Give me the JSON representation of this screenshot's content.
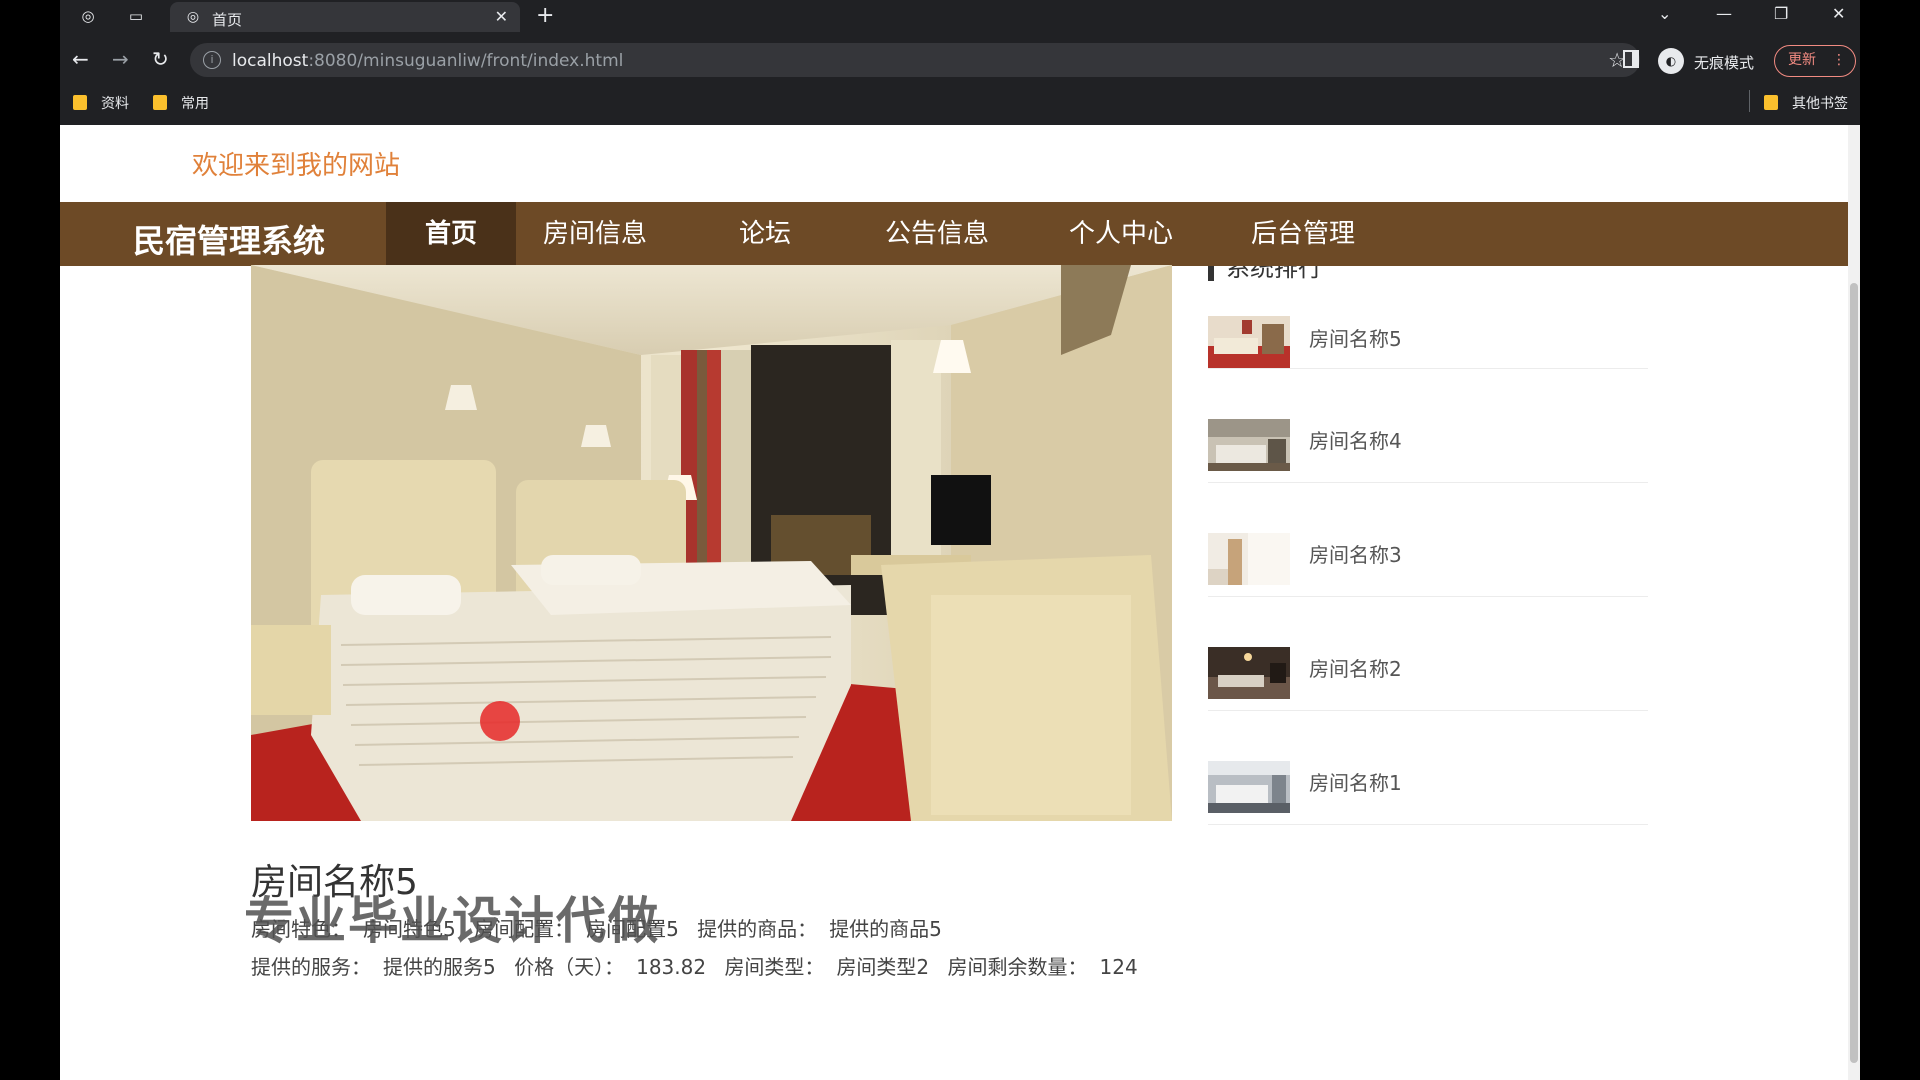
{
  "browser": {
    "tab_title": "首页",
    "url_host": "localhost",
    "url_rest": ":8080/minsuguanliw/front/index.html",
    "incognito_label": "无痕模式",
    "update_label": "更新",
    "bookmarks": [
      "资料",
      "常用"
    ],
    "other_bookmarks": "其他书签"
  },
  "site": {
    "welcome": "欢迎来到我的网站",
    "brand": "民宿管理系统",
    "nav": [
      "首页",
      "房间信息",
      "论坛",
      "公告信息",
      "个人中心",
      "后台管理"
    ],
    "active_nav": "首页"
  },
  "sidebar": {
    "title": "系统排行",
    "rooms": [
      {
        "name": "房间名称5"
      },
      {
        "name": "房间名称4"
      },
      {
        "name": "房间名称3"
      },
      {
        "name": "房间名称2"
      },
      {
        "name": "房间名称1"
      }
    ]
  },
  "detail": {
    "title": "房间名称5",
    "row1": [
      {
        "label": "房间特色：",
        "value": "房间特色5"
      },
      {
        "label": "房间配置：",
        "value": "房间配置5"
      },
      {
        "label": "提供的商品：",
        "value": "提供的商品5"
      }
    ],
    "row2": [
      {
        "label": "提供的服务：",
        "value": "提供的服务5"
      },
      {
        "label": "价格（天）：",
        "value": "183.82"
      },
      {
        "label": "房间类型：",
        "value": "房间类型2"
      },
      {
        "label": "房间剩余数量：",
        "value": "124"
      }
    ]
  },
  "overlay": {
    "watermark": "专业毕业设计代做"
  },
  "colors": {
    "navbar": "#6d4a26",
    "navbar_active": "#4a3119",
    "welcome": "#e0813a"
  }
}
